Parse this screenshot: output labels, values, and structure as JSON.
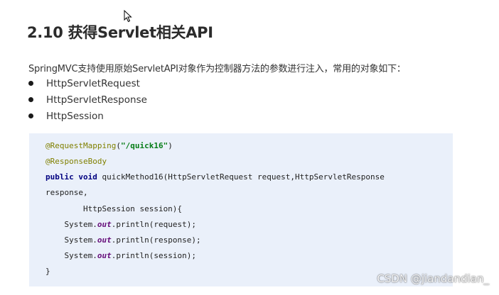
{
  "heading": "2.10 获得Servlet相关API",
  "intro": "SpringMVC支持使用原始ServletAPI对象作为控制器方法的参数进行注入，常用的对象如下：",
  "bullets": [
    "HttpServletRequest",
    "HttpServletResponse",
    "HttpSession"
  ],
  "code": {
    "line1": {
      "ann": "@RequestMapping",
      "open": "(",
      "str": "\"/quick16\"",
      "close": ")"
    },
    "line2": {
      "ann": "@ResponseBody"
    },
    "line3": {
      "kw1": "public",
      "kw2": "void",
      "rest": " quickMethod16(HttpServletRequest request,HttpServletResponse"
    },
    "line4": "response,",
    "line5": "        HttpSession session){",
    "line6": {
      "pre": "    System.",
      "field": "out",
      "post": ".println(request);"
    },
    "line7": {
      "pre": "    System.",
      "field": "out",
      "post": ".println(response);"
    },
    "line8": {
      "pre": "    System.",
      "field": "out",
      "post": ".println(session);"
    },
    "line9": "}"
  },
  "watermark": "CSDN @jiandandian_",
  "colors": {
    "code_bg": "#eaf0fa",
    "annotation": "#808000",
    "string": "#067d17",
    "keyword": "#000080",
    "field": "#660e7a"
  },
  "icons": {
    "cursor": "mouse-cursor-icon"
  }
}
